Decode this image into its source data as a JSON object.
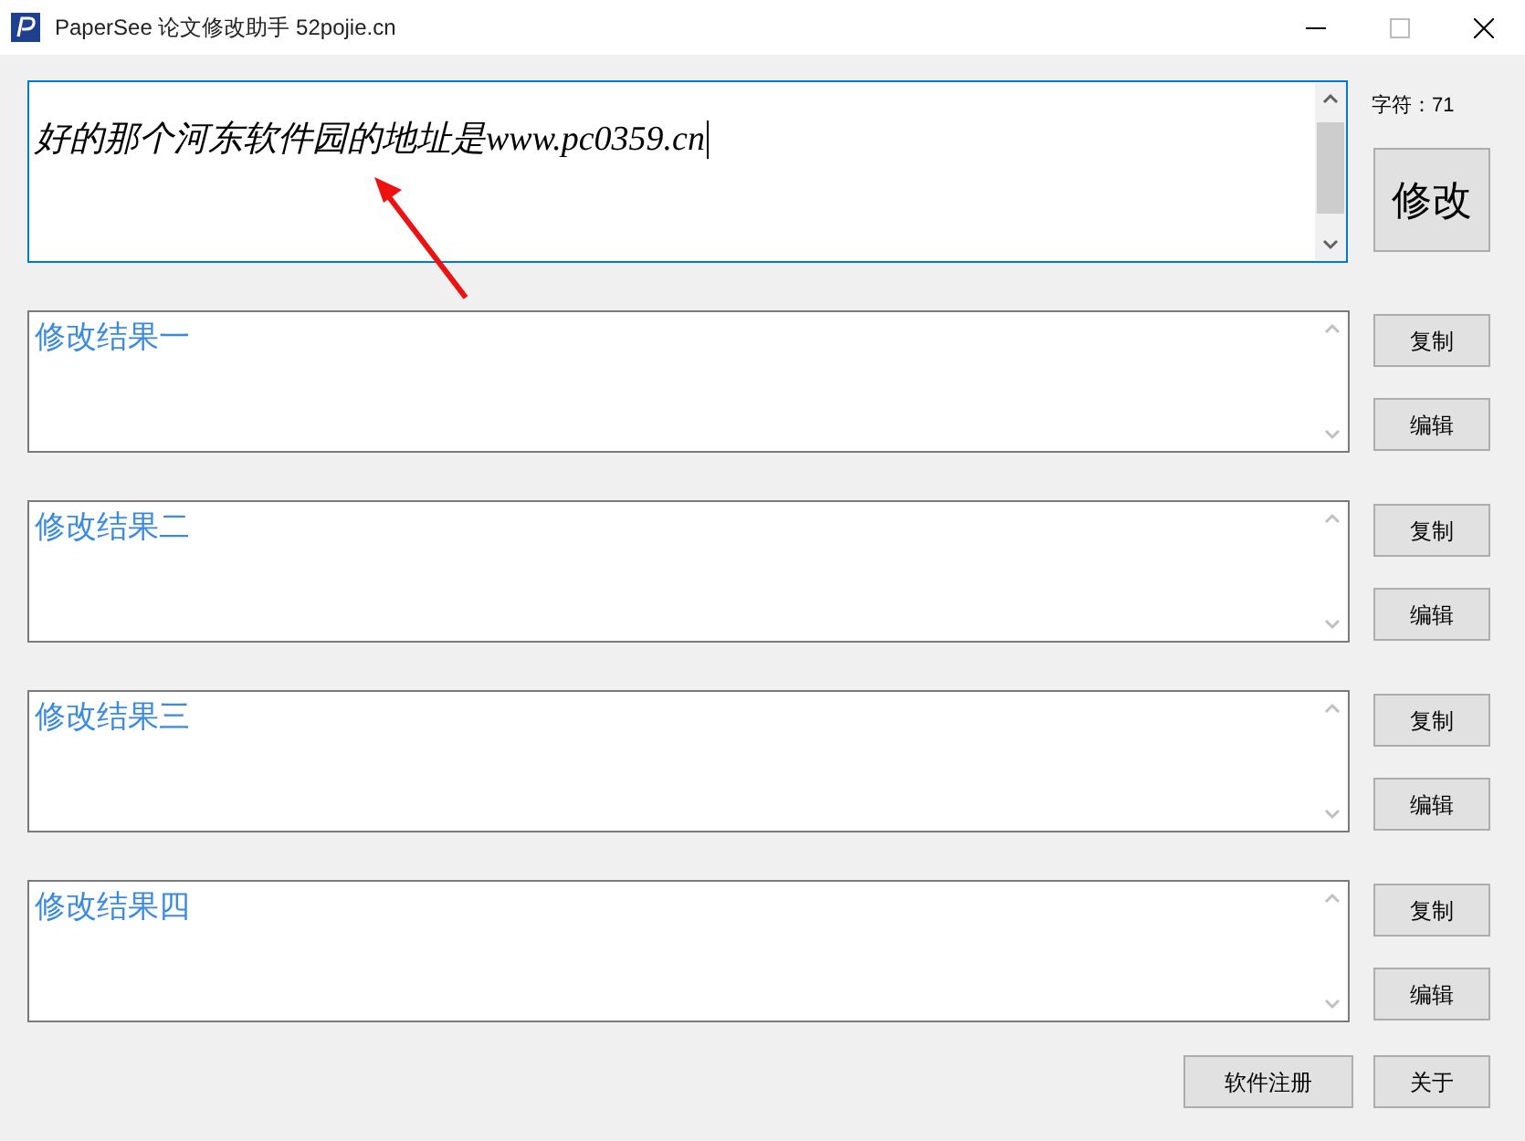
{
  "window": {
    "title": "PaperSee 论文修改助手 52pojie.cn"
  },
  "input": {
    "value": "好的那个河东软件园的地址是www.pc0359.cn"
  },
  "char_count": "字符：71",
  "modify_button": "修改",
  "results": [
    {
      "text": "修改结果一",
      "copy": "复制",
      "edit": "编辑"
    },
    {
      "text": "修改结果二",
      "copy": "复制",
      "edit": "编辑"
    },
    {
      "text": "修改结果三",
      "copy": "复制",
      "edit": "编辑"
    },
    {
      "text": "修改结果四",
      "copy": "复制",
      "edit": "编辑"
    }
  ],
  "footer_buttons": [
    "软件注册",
    "关于"
  ]
}
